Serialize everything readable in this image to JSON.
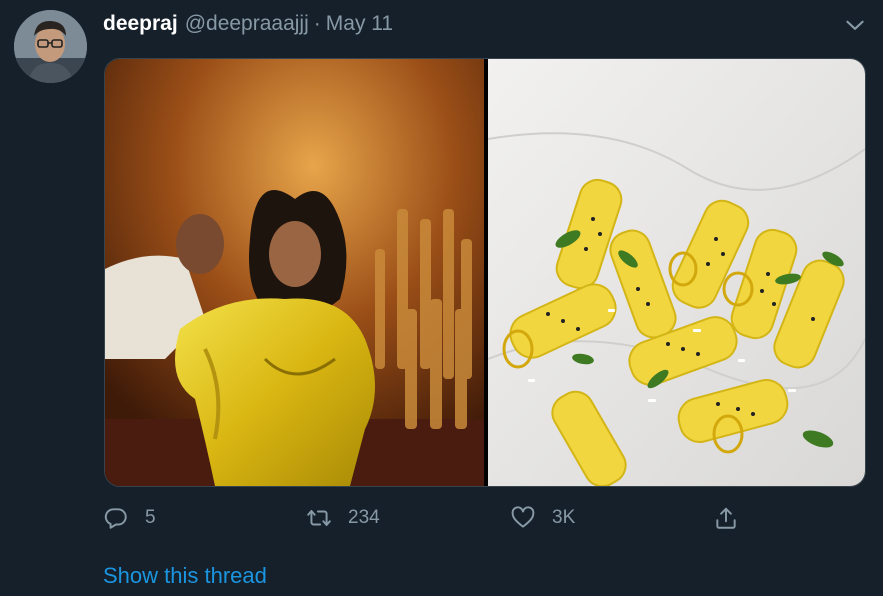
{
  "tweet": {
    "author_name": "deepraj",
    "handle": "@deepraaajjj",
    "separator": "·",
    "date": "May 11",
    "stats": {
      "replies": "5",
      "retweets": "234",
      "likes": "3K"
    },
    "show_thread_label": "Show this thread"
  },
  "images": [
    {
      "name": "photo-woman-in-yellow-dress"
    },
    {
      "name": "photo-yellow-rolled-snack"
    }
  ],
  "icons": [
    "chevron-down-icon",
    "reply-icon",
    "retweet-icon",
    "like-icon",
    "share-icon"
  ],
  "colors": {
    "background": "#15202b",
    "secondary_text": "#8899a6",
    "link": "#1b95e0",
    "border": "#38444d"
  }
}
